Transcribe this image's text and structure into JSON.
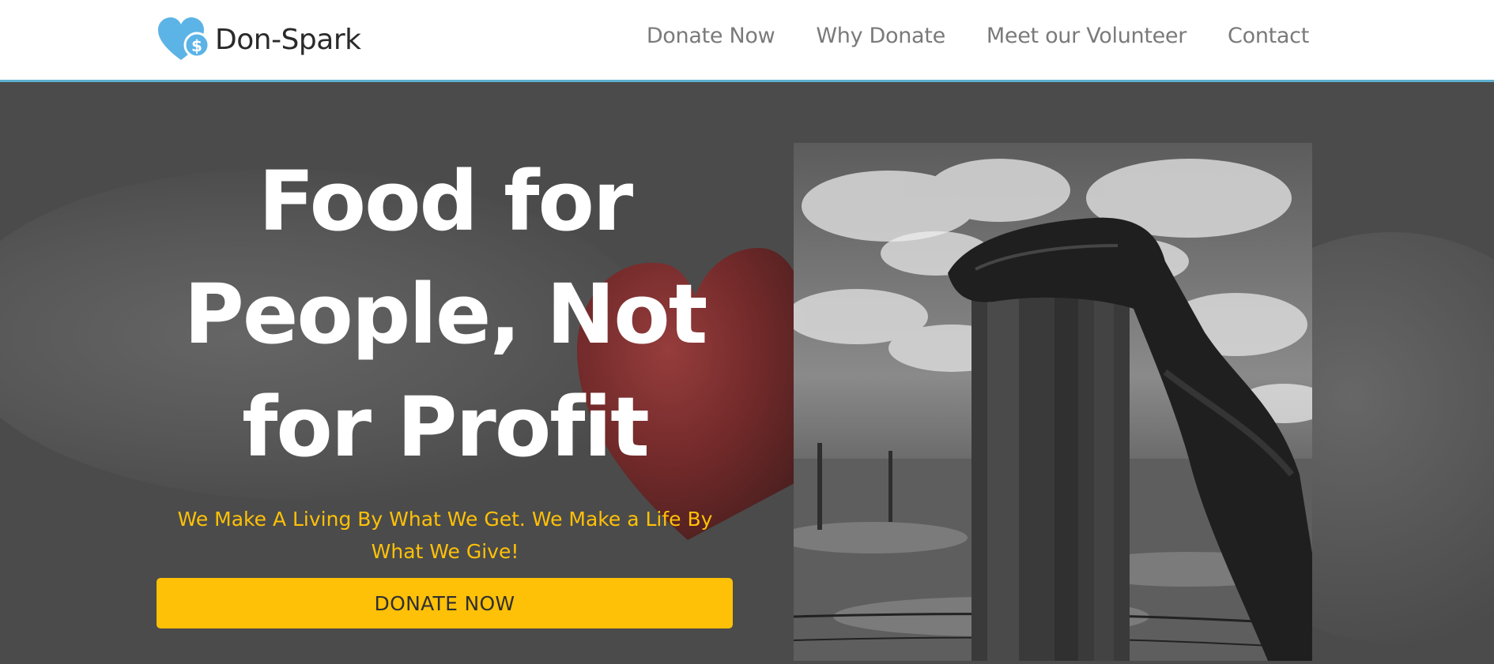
{
  "brand": {
    "name": "Don-Spark",
    "logo_icon": "heart-dollar-icon",
    "logo_color": "#5cb3e6"
  },
  "nav": {
    "items": [
      "Donate Now",
      "Why Donate",
      "Meet our Volunteer",
      "Contact"
    ]
  },
  "hero": {
    "headline_lines": [
      "Food for",
      "People, Not",
      "for Profit"
    ],
    "tagline": "We Make A Living By What We Get. We Make a Life By What We Give!",
    "cta_label": "DONATE NOW"
  },
  "colors": {
    "accent": "#ffc107",
    "header_border": "#5fb0cf",
    "hero_bg": "#4b4b4b"
  }
}
